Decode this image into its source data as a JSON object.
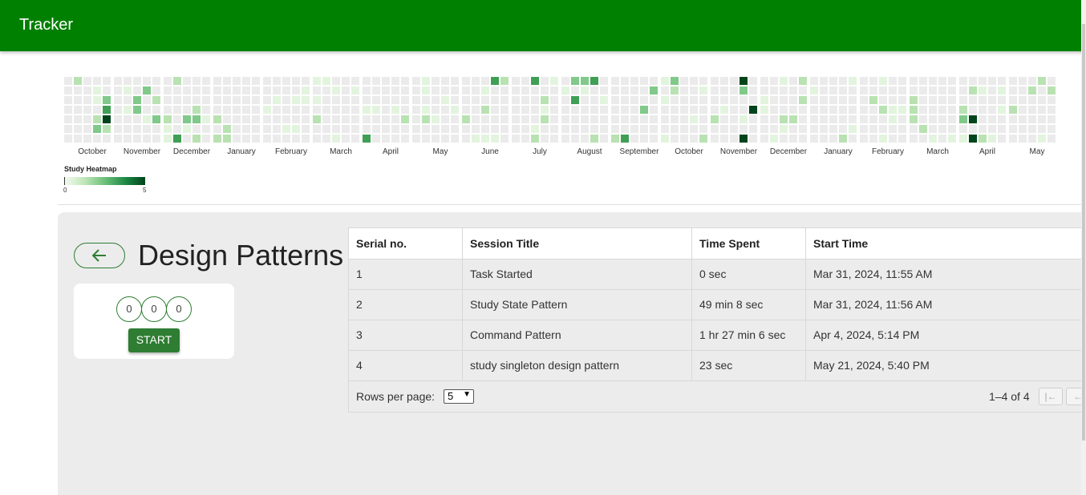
{
  "appbar": {
    "title": "Tracker"
  },
  "heatmap": {
    "months": [
      "October",
      "November",
      "December",
      "January",
      "February",
      "March",
      "April",
      "May",
      "June",
      "July",
      "August",
      "September",
      "October",
      "November",
      "December",
      "January",
      "February",
      "March",
      "April",
      "May"
    ],
    "legend": {
      "title": "Study Heatmap",
      "min_label": "0",
      "max_label": "5"
    },
    "colors": {
      "empty": "#ebebeb",
      "l1": "#e3f4de",
      "l2": "#b9e2b2",
      "l3": "#80c98a",
      "l4": "#3f9f55",
      "l5": "#00441b"
    }
  },
  "task": {
    "title": "Design Patterns",
    "back_icon": "arrow-left-icon"
  },
  "timer": {
    "digits": [
      "0",
      "0",
      "0"
    ],
    "start_label": "START"
  },
  "table": {
    "headers": [
      "Serial no.",
      "Session Title",
      "Time Spent",
      "Start Time"
    ],
    "rows": [
      {
        "serial": "1",
        "title": "Task Started",
        "time": "0 sec",
        "start": "Mar 31, 2024, 11:55 AM"
      },
      {
        "serial": "2",
        "title": "Study State Pattern",
        "time": "49 min 8 sec",
        "start": "Mar 31, 2024, 11:56 AM"
      },
      {
        "serial": "3",
        "title": "Command Pattern",
        "time": "1 hr 27 min 6 sec",
        "start": "Apr 4, 2024, 5:14 PM"
      },
      {
        "serial": "4",
        "title": "study singleton design pattern",
        "time": "23 sec",
        "start": "May 21, 2024, 5:40 PM"
      }
    ],
    "footer": {
      "rows_per_page_label": "Rows per page:",
      "rows_per_page_value": "5",
      "range_text": "1–4 of 4",
      "first_page_icon": "first-page-icon",
      "prev_page_icon": "prev-page-icon"
    }
  }
}
